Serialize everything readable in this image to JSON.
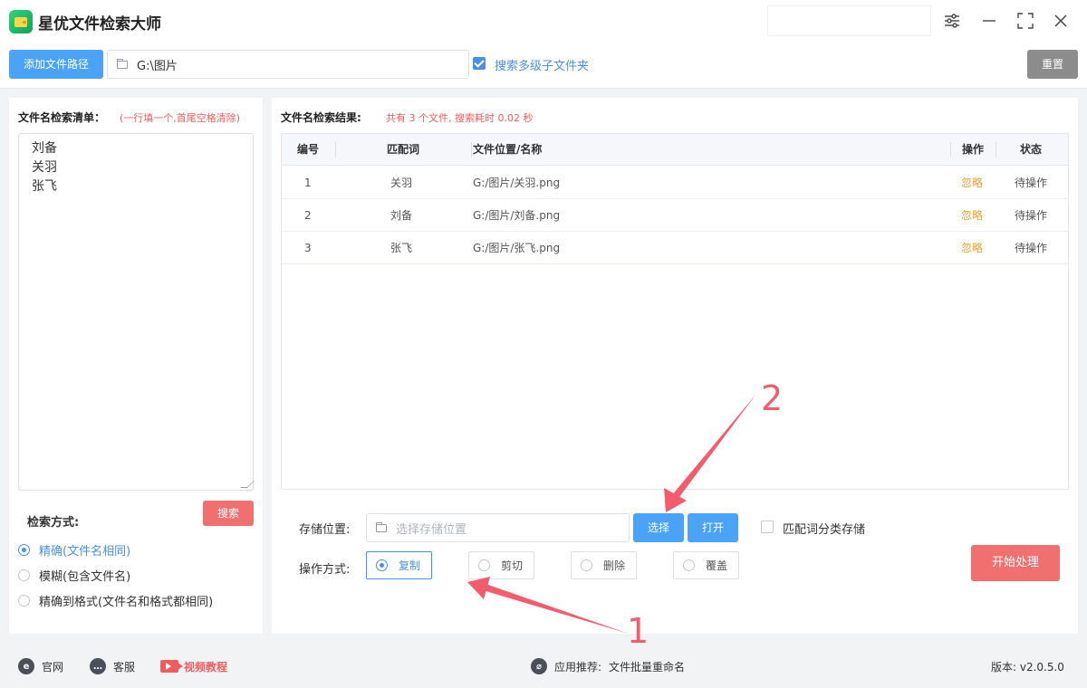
{
  "app": {
    "title": "星优文件检索大师"
  },
  "toolbar": {
    "add_path_label": "添加文件路径",
    "path_value": "G:\\图片",
    "include_subfolders_label": "搜索多级子文件夹",
    "include_subfolders_checked": true,
    "reset_label": "重置"
  },
  "left": {
    "title": "文件名检索清单：",
    "hint": "(一行填一个,首尾空格清除)",
    "names": [
      "刘备",
      "关羽",
      "张飞"
    ],
    "search_mode_label": "检索方式:",
    "search_button": "搜索",
    "modes": [
      {
        "label": "精确(文件名相同)",
        "selected": true
      },
      {
        "label": "模糊(包含文件名)",
        "selected": false
      },
      {
        "label": "精确到格式(文件名和格式都相同)",
        "selected": false
      }
    ]
  },
  "results": {
    "title": "文件名检索结果:",
    "summary": "共有 3 个文件, 搜索耗时 0.02 秒",
    "columns": [
      "编号",
      "匹配词",
      "文件位置/名称",
      "操作",
      "状态"
    ],
    "rows": [
      {
        "no": "1",
        "keyword": "关羽",
        "path": "G:/图片/关羽.png",
        "action": "忽略",
        "status": "待操作"
      },
      {
        "no": "2",
        "keyword": "刘备",
        "path": "G:/图片/刘备.png",
        "action": "忽略",
        "status": "待操作"
      },
      {
        "no": "3",
        "keyword": "张飞",
        "path": "G:/图片/张飞.png",
        "action": "忽略",
        "status": "待操作"
      }
    ]
  },
  "output": {
    "storage_label": "存储位置:",
    "storage_placeholder": "选择存储位置",
    "select_button": "选择",
    "open_button": "打开",
    "classify_label": "匹配词分类存储",
    "operation_label": "操作方式:",
    "operations": [
      {
        "label": "复制",
        "selected": true
      },
      {
        "label": "剪切",
        "selected": false
      },
      {
        "label": "删除",
        "selected": false
      },
      {
        "label": "覆盖",
        "selected": false
      }
    ],
    "start_button": "开始处理"
  },
  "annotations": {
    "step1": "1",
    "step2": "2",
    "color": "#f25c6c"
  },
  "statusbar": {
    "website": "官网",
    "support": "客服",
    "video_tutorial": "视频教程",
    "recommend_label": "应用推荐:",
    "recommend_app": "文件批量重命名",
    "version": "版本: v2.0.5.0"
  },
  "colors": {
    "primary": "#4aa3f7",
    "danger": "#f07070",
    "warning": "#f0a030",
    "neutral": "#8c8c8c"
  }
}
